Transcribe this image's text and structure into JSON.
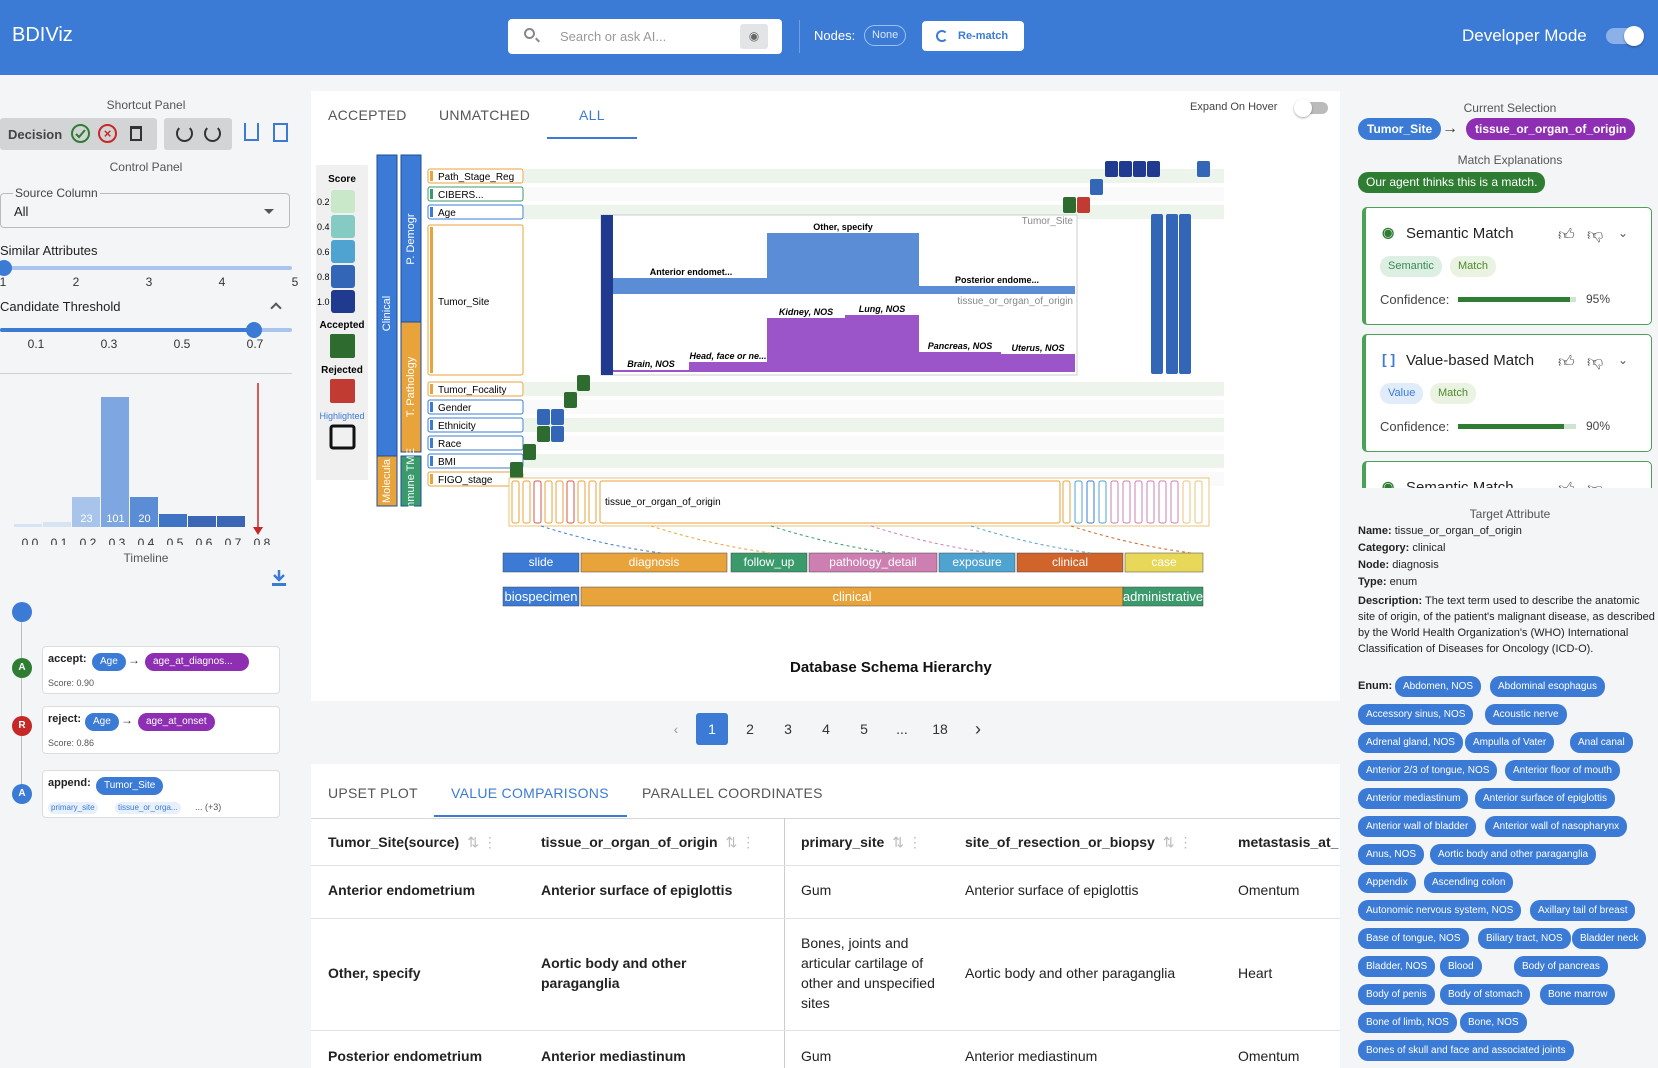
{
  "header": {
    "brand": "BDIViz",
    "search_placeholder": "Search or ask AI...",
    "nodes_label": "Nodes:",
    "nodes_value": "None",
    "rematch": "Re-match",
    "dev_mode": "Developer Mode"
  },
  "left": {
    "shortcut_title": "Shortcut Panel",
    "decision": "Decision",
    "control_title": "Control Panel",
    "source_label": "Source Column",
    "source_value": "All",
    "similar_label": "Similar Attributes",
    "similar_ticks": [
      "1",
      "2",
      "3",
      "4",
      "5"
    ],
    "similar_value": 1,
    "threshold_label": "Candidate Threshold",
    "threshold_ticks": [
      "0.1",
      "0.3",
      "0.5",
      "0.7"
    ],
    "threshold_value": 0.7,
    "hist_ticks": [
      "0.0",
      "0.1",
      "0.2",
      "0.3",
      "0.4",
      "0.5",
      "0.6",
      "0.7",
      "0.8"
    ],
    "hist_labels": [
      "23",
      "101",
      "20"
    ],
    "timeline_title": "Timeline",
    "timeline": [
      {
        "badge": "A",
        "action": "accept:",
        "source": "Age",
        "target": "age_at_diagnos...",
        "score": "Score: 0.90"
      },
      {
        "badge": "R",
        "action": "reject:",
        "source": "Age",
        "target": "age_at_onset",
        "score": "Score: 0.86"
      },
      {
        "badge": "A",
        "action": "append:",
        "source": "Tumor_Site",
        "mini1": "primary_site",
        "mini2": "tissue_or_orga...",
        "more": "... (+3)"
      }
    ]
  },
  "center": {
    "tabs": [
      "ACCEPTED",
      "UNMATCHED",
      "ALL"
    ],
    "expand_label": "Expand On Hover",
    "legend": {
      "score": "Score",
      "scores": [
        "0.2",
        "0.4",
        "0.6",
        "0.8",
        "1.0"
      ],
      "accepted": "Accepted",
      "rejected": "Rejected",
      "highlighted": "Highlighted"
    },
    "groups": [
      "Clinical",
      "P. Demogr",
      "T. Pathology",
      "Molecula",
      "Immune TME"
    ],
    "rows": [
      "Path_Stage_Reg",
      "CIBERS...",
      "Age",
      "Tumor_Site",
      "Tumor_Focality",
      "Gender",
      "Ethnicity",
      "Race",
      "BMI",
      "FIGO_stage"
    ],
    "expand": {
      "label_top": "Tumor_Site",
      "label_bottom": "tissue_or_organ_of_origin",
      "top_bars": [
        "Anterior endomet...",
        "Other, specify",
        "Posterior endome..."
      ],
      "bottom_bars": [
        "Brain, NOS",
        "Head, face or ne...",
        "Kidney, NOS",
        "Lung, NOS",
        "Pancreas, NOS",
        "Uterus, NOS"
      ]
    },
    "target_label": "tissue_or_organ_of_origin",
    "nodes": [
      "slide",
      "diagnosis",
      "follow_up",
      "pathology_detail",
      "exposure",
      "clinical",
      "case"
    ],
    "categories": [
      "biospecimen",
      "clinical",
      "administrative"
    ],
    "schema_title": "Database Schema Hierarchy",
    "pages": [
      "1",
      "2",
      "3",
      "4",
      "5",
      "...",
      "18"
    ]
  },
  "bottom": {
    "tabs": [
      "UPSET PLOT",
      "VALUE COMPARISONS",
      "PARALLEL COORDINATES"
    ],
    "cols": [
      "Tumor_Site(source)",
      "tissue_or_organ_of_origin",
      "primary_site",
      "site_of_resection_or_biopsy",
      "metastasis_at_"
    ],
    "rows": [
      [
        "Anterior endometrium",
        "Anterior surface of epiglottis",
        "Gum",
        "Anterior surface of epiglottis",
        "Omentum"
      ],
      [
        "Other, specify",
        "Aortic body and other paraganglia",
        "Bones, joints and articular cartilage of other and unspecified sites",
        "Aortic body and other paraganglia",
        "Heart"
      ],
      [
        "Posterior endometrium",
        "Anterior mediastinum",
        "Gum",
        "Anterior mediastinum",
        "Omentum"
      ]
    ]
  },
  "right": {
    "current_title": "Current Selection",
    "src": "Tumor_Site",
    "tgt": "tissue_or_organ_of_origin",
    "expl_title": "Match Explanations",
    "agent": "Our agent thinks this is a match.",
    "cards": [
      {
        "title": "Semantic Match",
        "tag1": "Semantic",
        "tag2": "Match",
        "conf_label": "Confidence:",
        "pct": "95%",
        "value": 0.95
      },
      {
        "title": "Value-based Match",
        "tag1": "Value",
        "tag2": "Match",
        "conf_label": "Confidence:",
        "pct": "90%",
        "value": 0.9
      },
      {
        "title": "Semantic Match"
      }
    ],
    "target_title": "Target Attribute",
    "name_k": "Name:",
    "name_v": "tissue_or_organ_of_origin",
    "cat_k": "Category:",
    "cat_v": "clinical",
    "node_k": "Node:",
    "node_v": "diagnosis",
    "type_k": "Type:",
    "type_v": "enum",
    "desc_k": "Description:",
    "desc_v": "The text term used to describe the anatomic site of origin, of the patient's malignant disease, as described by the World Health Organization's (WHO) International Classification of Diseases for Oncology (ICD-O).",
    "enum_k": "Enum:",
    "enums": [
      "Abdomen, NOS",
      "Abdominal esophagus",
      "Accessory sinus, NOS",
      "Acoustic nerve",
      "Adrenal gland, NOS",
      "Ampulla of Vater",
      "Anal canal",
      "Anterior 2/3 of tongue, NOS",
      "Anterior floor of mouth",
      "Anterior mediastinum",
      "Anterior surface of epiglottis",
      "Anterior wall of bladder",
      "Anterior wall of nasopharynx",
      "Anus, NOS",
      "Aortic body and other paraganglia",
      "Appendix",
      "Ascending colon",
      "Autonomic nervous system, NOS",
      "Axillary tail of breast",
      "Base of tongue, NOS",
      "Biliary tract, NOS",
      "Bladder neck",
      "Bladder, NOS",
      "Blood",
      "Body of pancreas",
      "Body of penis",
      "Body of stomach",
      "Bone marrow",
      "Bone of limb, NOS",
      "Bone, NOS",
      "Bones of skull and face and associated joints"
    ]
  }
}
